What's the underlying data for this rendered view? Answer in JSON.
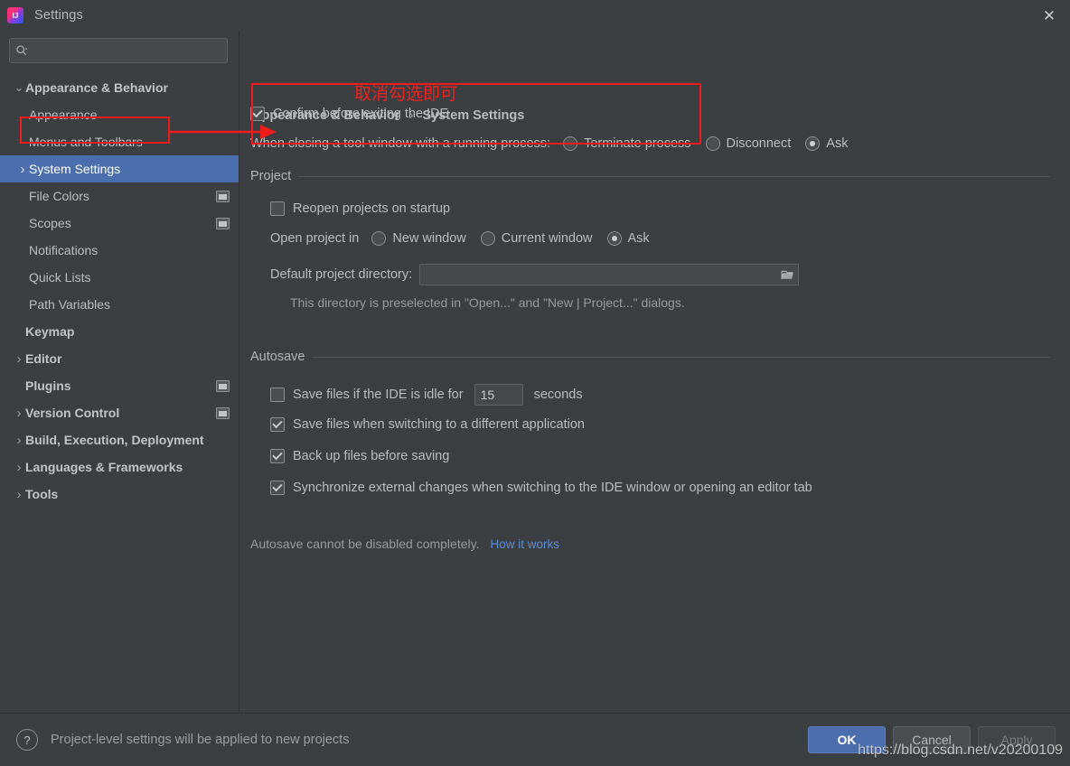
{
  "window": {
    "title": "Settings",
    "logo_icon": "jetbrains-intellij-icon",
    "close_icon": "close-icon"
  },
  "sidebar": {
    "search": {
      "placeholder": "",
      "value": "",
      "icon": "search-icon"
    },
    "items": [
      {
        "label": "Appearance & Behavior",
        "level": 0,
        "arrow": "chevron-down-icon",
        "bold": true,
        "selected": false,
        "badge": false
      },
      {
        "label": "Appearance",
        "level": 1,
        "arrow": "",
        "bold": false,
        "selected": false,
        "badge": false
      },
      {
        "label": "Menus and Toolbars",
        "level": 1,
        "arrow": "",
        "bold": false,
        "selected": false,
        "badge": false
      },
      {
        "label": "System Settings",
        "level": 1,
        "arrow": "chevron-right-icon",
        "bold": false,
        "selected": true,
        "badge": false
      },
      {
        "label": "File Colors",
        "level": 1,
        "arrow": "",
        "bold": false,
        "selected": false,
        "badge": true
      },
      {
        "label": "Scopes",
        "level": 1,
        "arrow": "",
        "bold": false,
        "selected": false,
        "badge": true
      },
      {
        "label": "Notifications",
        "level": 1,
        "arrow": "",
        "bold": false,
        "selected": false,
        "badge": false
      },
      {
        "label": "Quick Lists",
        "level": 1,
        "arrow": "",
        "bold": false,
        "selected": false,
        "badge": false
      },
      {
        "label": "Path Variables",
        "level": 1,
        "arrow": "",
        "bold": false,
        "selected": false,
        "badge": false
      },
      {
        "label": "Keymap",
        "level": 0,
        "arrow": "",
        "bold": true,
        "selected": false,
        "badge": false
      },
      {
        "label": "Editor",
        "level": 0,
        "arrow": "chevron-right-icon",
        "bold": true,
        "selected": false,
        "badge": false
      },
      {
        "label": "Plugins",
        "level": 0,
        "arrow": "",
        "bold": true,
        "selected": false,
        "badge": true
      },
      {
        "label": "Version Control",
        "level": 0,
        "arrow": "chevron-right-icon",
        "bold": true,
        "selected": false,
        "badge": true
      },
      {
        "label": "Build, Execution, Deployment",
        "level": 0,
        "arrow": "chevron-right-icon",
        "bold": true,
        "selected": false,
        "badge": false
      },
      {
        "label": "Languages & Frameworks",
        "level": 0,
        "arrow": "chevron-right-icon",
        "bold": true,
        "selected": false,
        "badge": false
      },
      {
        "label": "Tools",
        "level": 0,
        "arrow": "chevron-right-icon",
        "bold": true,
        "selected": false,
        "badge": false
      }
    ]
  },
  "content": {
    "breadcrumb": {
      "parent": "Appearance & Behavior",
      "separator": "›",
      "current": "System Settings"
    },
    "confirm_exit": {
      "label": "Confirm before exiting the IDE",
      "checked": true
    },
    "tool_window": {
      "label": "When closing a tool window with a running process:",
      "options": [
        {
          "label": "Terminate process",
          "selected": false
        },
        {
          "label": "Disconnect",
          "selected": false
        },
        {
          "label": "Ask",
          "selected": true
        }
      ]
    },
    "project_group": {
      "title": "Project",
      "reopen": {
        "label": "Reopen projects on startup",
        "checked": false
      },
      "open_project_in": {
        "label": "Open project in",
        "options": [
          {
            "label": "New window",
            "selected": false
          },
          {
            "label": "Current window",
            "selected": false
          },
          {
            "label": "Ask",
            "selected": true
          }
        ]
      },
      "default_dir": {
        "label": "Default project directory:",
        "value": "",
        "placeholder": "",
        "browse_icon": "folder-icon"
      },
      "hint": "This directory is preselected in \"Open...\" and \"New | Project...\" dialogs."
    },
    "autosave_group": {
      "title": "Autosave",
      "idle": {
        "label": "Save files if the IDE is idle for",
        "checked": false,
        "value": "15",
        "unit": "seconds"
      },
      "items": [
        {
          "label": "Save files when switching to a different application",
          "checked": true
        },
        {
          "label": "Back up files before saving",
          "checked": true
        },
        {
          "label": "Synchronize external changes when switching to the IDE window or opening an editor tab",
          "checked": true
        }
      ],
      "note": "Autosave cannot be disabled completely.",
      "link": "How it works"
    }
  },
  "footer": {
    "help_icon": "question-mark-icon",
    "note": "Project-level settings will be applied to new projects",
    "buttons": [
      {
        "label": "OK",
        "style": "primary"
      },
      {
        "label": "Cancel",
        "style": "normal"
      },
      {
        "label": "Apply",
        "style": "disabled"
      }
    ]
  },
  "annotations": {
    "note_text": "取消勾选即可",
    "accent_color": "#ee1c1c"
  },
  "watermark": "https://blog.csdn.net/v20200109"
}
